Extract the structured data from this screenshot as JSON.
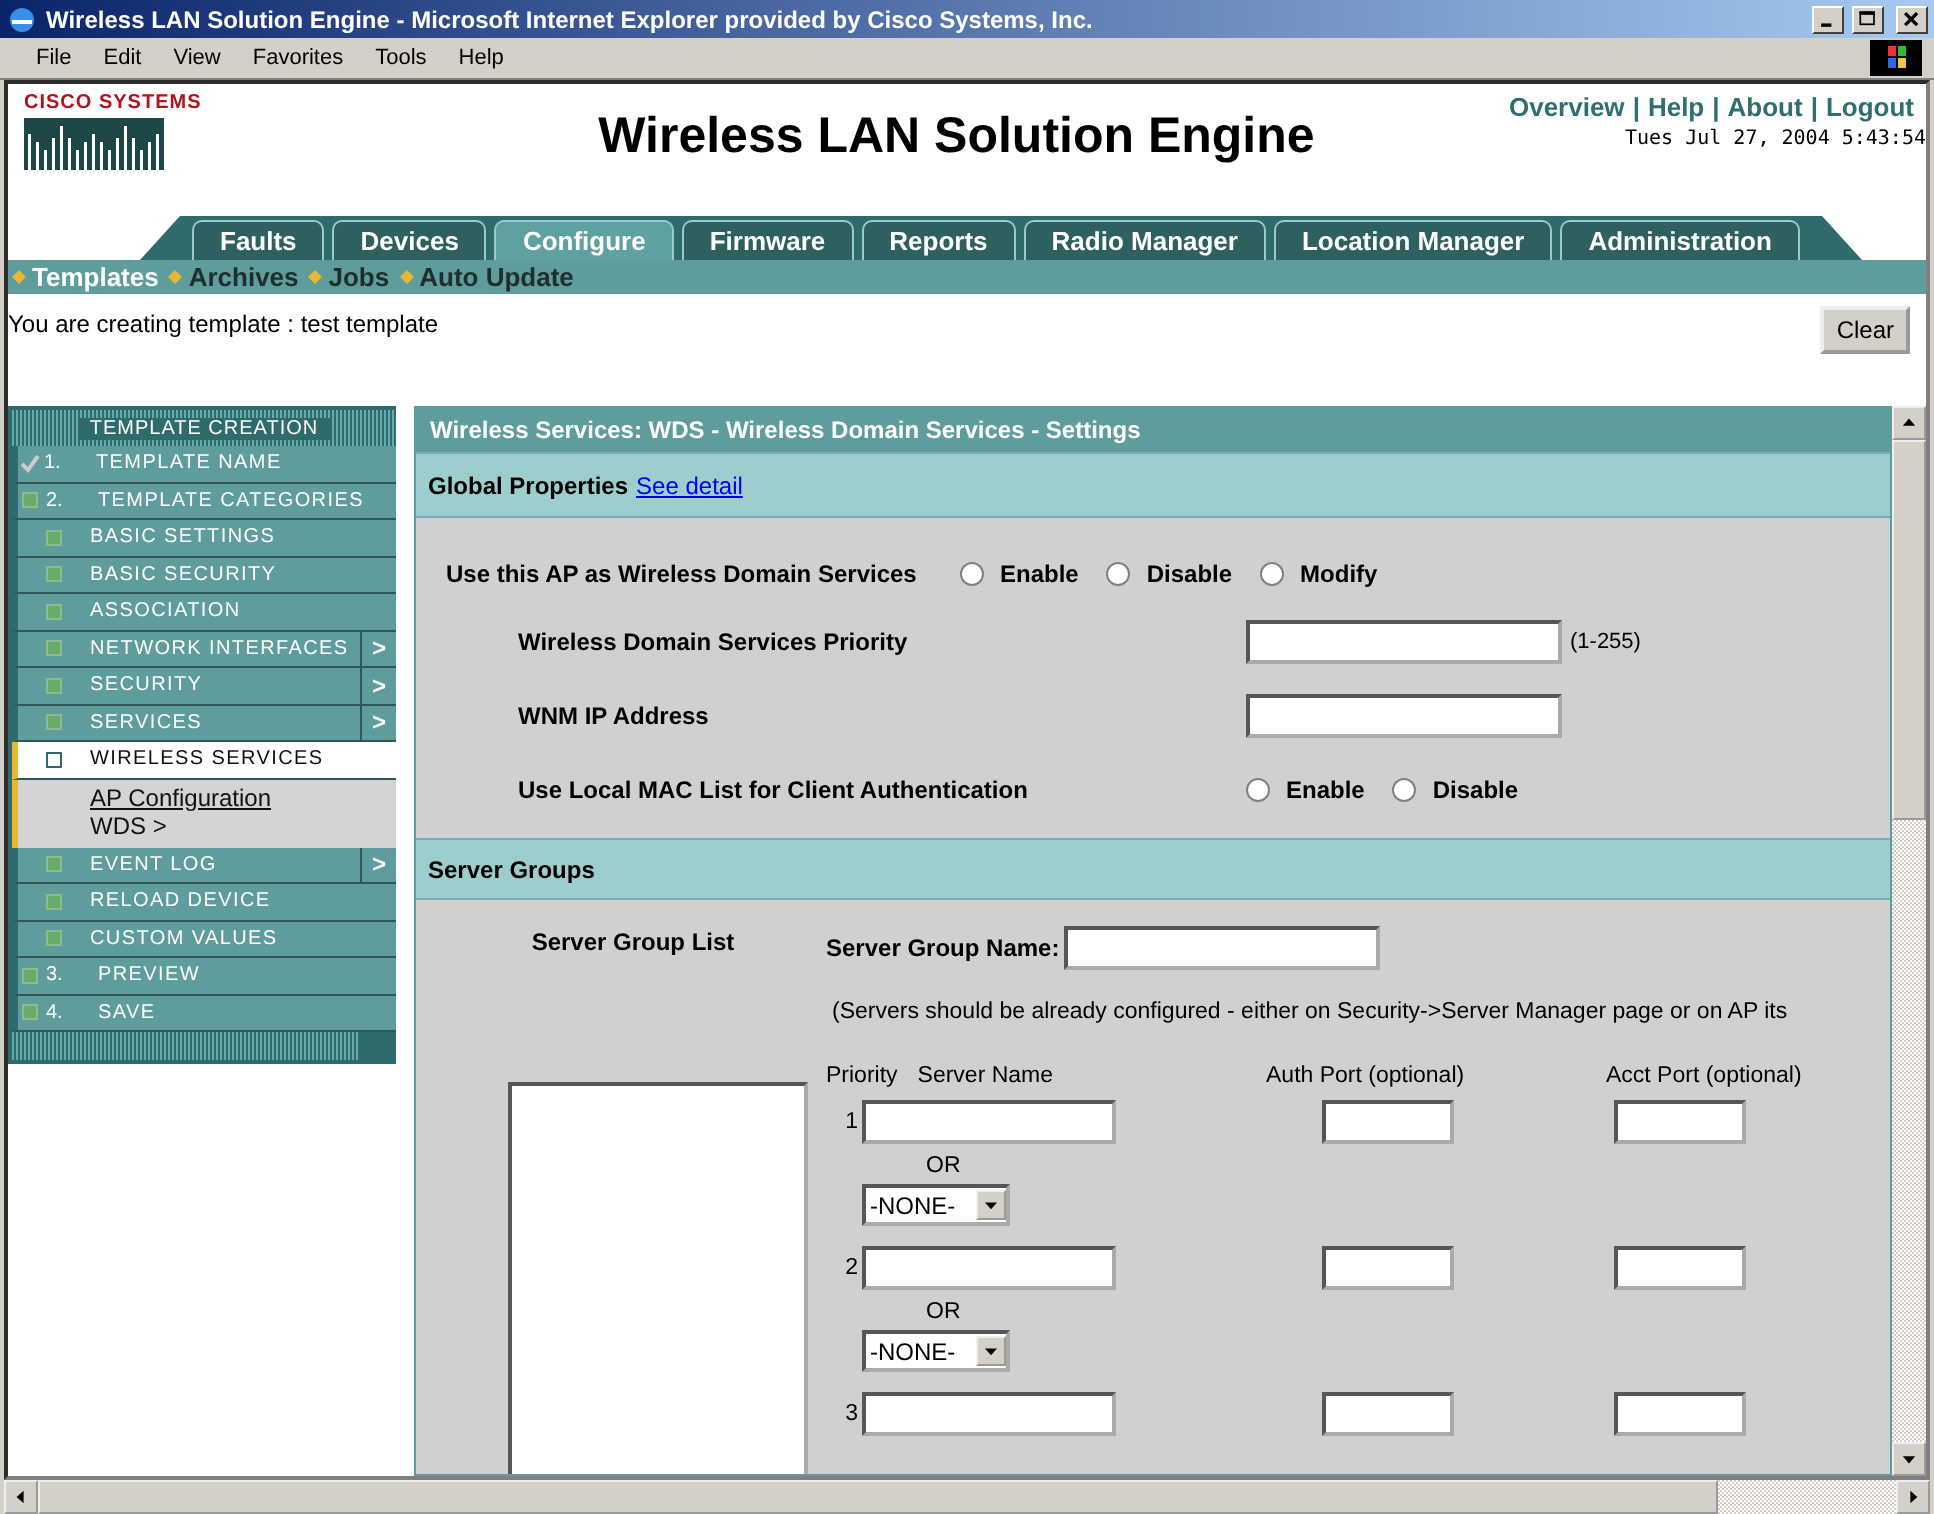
{
  "window": {
    "title": "Wireless LAN Solution Engine - Microsoft Internet Explorer provided by Cisco Systems, Inc."
  },
  "menu_bar": [
    "File",
    "Edit",
    "View",
    "Favorites",
    "Tools",
    "Help"
  ],
  "header": {
    "logo": "CISCO SYSTEMS",
    "title": "Wireless LAN Solution Engine",
    "links": [
      "Overview",
      "Help",
      "About",
      "Logout"
    ],
    "separator": "|",
    "datetime": "Tues Jul 27, 2004 5:43:54"
  },
  "tabs": [
    {
      "label": "Faults",
      "selected": false
    },
    {
      "label": "Devices",
      "selected": false
    },
    {
      "label": "Configure",
      "selected": true
    },
    {
      "label": "Firmware",
      "selected": false
    },
    {
      "label": "Reports",
      "selected": false
    },
    {
      "label": "Radio Manager",
      "selected": false
    },
    {
      "label": "Location Manager",
      "selected": false
    },
    {
      "label": "Administration",
      "selected": false
    }
  ],
  "subnav": [
    {
      "label": "Templates",
      "selected": true
    },
    {
      "label": "Archives",
      "selected": false
    },
    {
      "label": "Jobs",
      "selected": false
    },
    {
      "label": "Auto Update",
      "selected": false
    }
  ],
  "notice": "You are creating template : test template",
  "clear_button": "Clear",
  "sidebar": {
    "title": "TEMPLATE CREATION",
    "items": [
      {
        "number": "1.",
        "label": "TEMPLATE NAME",
        "checked": true
      },
      {
        "number": "2.",
        "label": "TEMPLATE CATEGORIES",
        "checked": false,
        "children": [
          {
            "label": "BASIC SETTINGS",
            "selected": false,
            "submenu": false
          },
          {
            "label": "BASIC SECURITY",
            "selected": false,
            "submenu": false
          },
          {
            "label": "ASSOCIATION",
            "selected": false,
            "submenu": false
          },
          {
            "label": "NETWORK INTERFACES",
            "selected": false,
            "submenu": true,
            "arrow": ">"
          },
          {
            "label": "SECURITY",
            "selected": false,
            "submenu": true,
            "arrow": ">"
          },
          {
            "label": "SERVICES",
            "selected": false,
            "submenu": true,
            "arrow": ">"
          },
          {
            "label": "WIRELESS SERVICES",
            "selected": true,
            "submenu": false,
            "children": [
              {
                "label": "AP Configuration",
                "kind": "link"
              },
              {
                "label": "WDS >",
                "kind": "current"
              }
            ]
          },
          {
            "label": "EVENT LOG",
            "selected": false,
            "submenu": true,
            "arrow": ">"
          },
          {
            "label": "RELOAD DEVICE",
            "selected": false,
            "submenu": false
          },
          {
            "label": "CUSTOM VALUES",
            "selected": false,
            "submenu": false
          }
        ]
      },
      {
        "number": "3.",
        "label": "PREVIEW",
        "checked": false
      },
      {
        "number": "4.",
        "label": "SAVE",
        "checked": false
      }
    ]
  },
  "panel": {
    "title": "Wireless Services: WDS - Wireless Domain Services - Settings",
    "global_properties": {
      "title": "Global Properties",
      "link": "See detail",
      "rows": [
        {
          "kind": "radio",
          "label": "Use this AP as Wireless Domain Services",
          "options": [
            {
              "label": "Enable",
              "selected": false
            },
            {
              "label": "Disable",
              "selected": false
            },
            {
              "label": "Modify",
              "selected": false
            }
          ]
        },
        {
          "kind": "text",
          "label": "Wireless Domain Services Priority",
          "hint": "(1-255)"
        },
        {
          "kind": "text",
          "label": "WNM IP Address"
        },
        {
          "kind": "radio",
          "label": "Use Local MAC List for Client Authentication",
          "options": [
            {
              "label": "Enable",
              "selected": false
            },
            {
              "label": "Disable",
              "selected": false
            }
          ]
        }
      ]
    },
    "server_groups": {
      "title": "Server Groups",
      "list_label": "Server Group List",
      "name_label": "Server Group Name:",
      "note": "(Servers should be already configured - either on Security->Server Manager page or on AP its",
      "columns": [
        "Priority",
        "Server Name",
        "Auth Port (optional)",
        "Acct Port (optional)"
      ],
      "rows": [
        {
          "priority": "1",
          "or": "OR",
          "select": "-NONE-"
        },
        {
          "priority": "2",
          "or": "OR",
          "select": "-NONE-"
        },
        {
          "priority": "3"
        }
      ]
    }
  }
}
